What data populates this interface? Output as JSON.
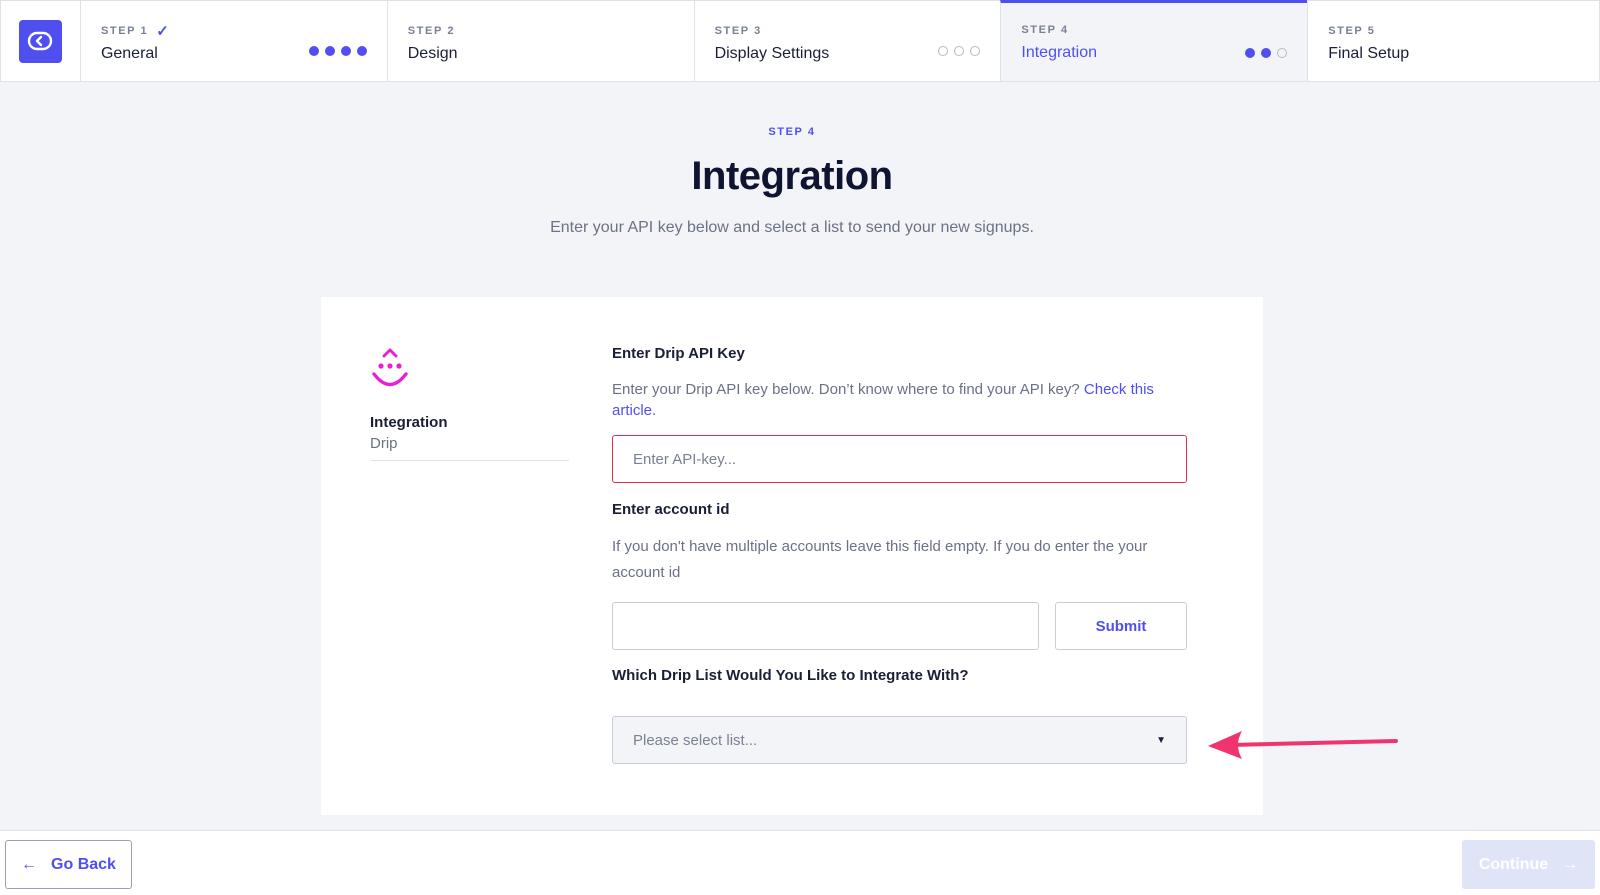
{
  "steps": [
    {
      "num": "STEP 1",
      "title": "General",
      "done": true,
      "dots": [
        true,
        true,
        true,
        true
      ]
    },
    {
      "num": "STEP 2",
      "title": "Design",
      "done": false,
      "dots": []
    },
    {
      "num": "STEP 3",
      "title": "Display Settings",
      "done": false,
      "dots": [
        false,
        false,
        false
      ]
    },
    {
      "num": "STEP 4",
      "title": "Integration",
      "done": false,
      "active": true,
      "dots": [
        true,
        true,
        false
      ]
    },
    {
      "num": "STEP 5",
      "title": "Final Setup",
      "done": false,
      "dots": []
    }
  ],
  "header": {
    "eyebrow": "STEP 4",
    "title": "Integration",
    "subtitle": "Enter your API key below and select a list to send your new signups."
  },
  "sidebar": {
    "title": "Integration",
    "provider": "Drip"
  },
  "form": {
    "api_key_label": "Enter Drip API Key",
    "api_key_help": "Enter your Drip API key below. Don’t know where to find your API key?",
    "api_key_link": "Check this article.",
    "api_key_placeholder": "Enter API-key...",
    "api_key_value": "",
    "account_label": "Enter account id",
    "account_help": "If you don't have multiple accounts leave this field empty. If you do enter the your account id",
    "account_value": "",
    "submit_label": "Submit",
    "list_label": "Which Drip List Would You Like to Integrate With?",
    "list_placeholder": "Please select list..."
  },
  "footer": {
    "back_label": "Go Back",
    "continue_label": "Continue"
  },
  "colors": {
    "accent": "#4f4ff0",
    "drip_brand": "#e81fd2",
    "error": "#e0344d",
    "annotation_arrow": "#f0356e"
  }
}
